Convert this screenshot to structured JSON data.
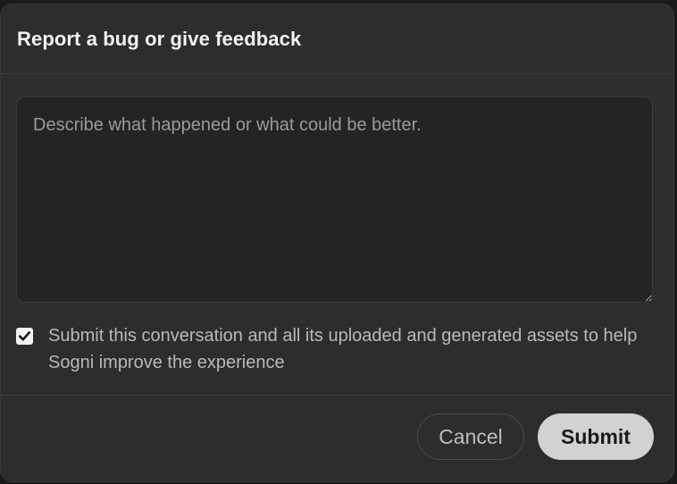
{
  "dialog": {
    "title": "Report a bug or give feedback",
    "textarea": {
      "placeholder": "Describe what happened or what could be better.",
      "value": ""
    },
    "consent": {
      "checked": true,
      "label": "Submit this conversation and all its uploaded and generated assets to help Sogni improve the experience"
    },
    "actions": {
      "cancel_label": "Cancel",
      "submit_label": "Submit"
    }
  },
  "icons": {
    "checkbox": "checkmark-icon"
  }
}
